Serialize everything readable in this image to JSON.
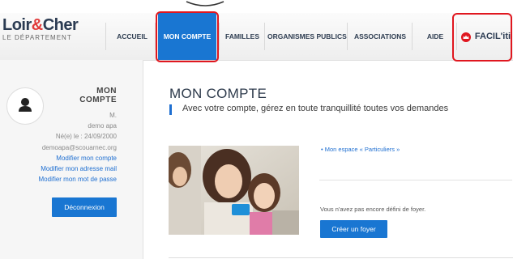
{
  "header": {
    "logo_main_a": "Loir",
    "logo_amp": "&",
    "logo_main_b": "Cher",
    "logo_sub": "LE DÉPARTEMENT",
    "nav": [
      "ACCUEIL",
      "MON COMPTE",
      "FAMILLES",
      "ORGANISMES PUBLICS",
      "ASSOCIATIONS",
      "AIDE"
    ],
    "active_index": 1,
    "facil_label": "FACIL'iti",
    "facil_icon": "crown-icon"
  },
  "sidebar": {
    "title_line1": "MON",
    "title_line2": "COMPTE",
    "avatar_icon": "user-icon",
    "civility": "M.",
    "name": "demo apa",
    "birth": "Né(e) le : 24/09/2000",
    "email": "demoapa@scouarnec.org",
    "links": [
      "Modifier mon compte",
      "Modifier mon adresse mail",
      "Modifier mon mot de passe"
    ],
    "logout_label": "Déconnexion"
  },
  "main": {
    "title": "MON COMPTE",
    "intro": "Avec votre compte, gérez en toute tranquillité toutes vos demandes",
    "espace_link": "Mon espace « Particuliers »",
    "no_foyer": "Vous n'avez pas encore défini de foyer.",
    "create_foyer": "Créer un foyer"
  },
  "colors": {
    "accent": "#1976d2",
    "highlight": "#e0171f",
    "link": "#1f6fd1",
    "nav_text": "#2f3e52"
  }
}
